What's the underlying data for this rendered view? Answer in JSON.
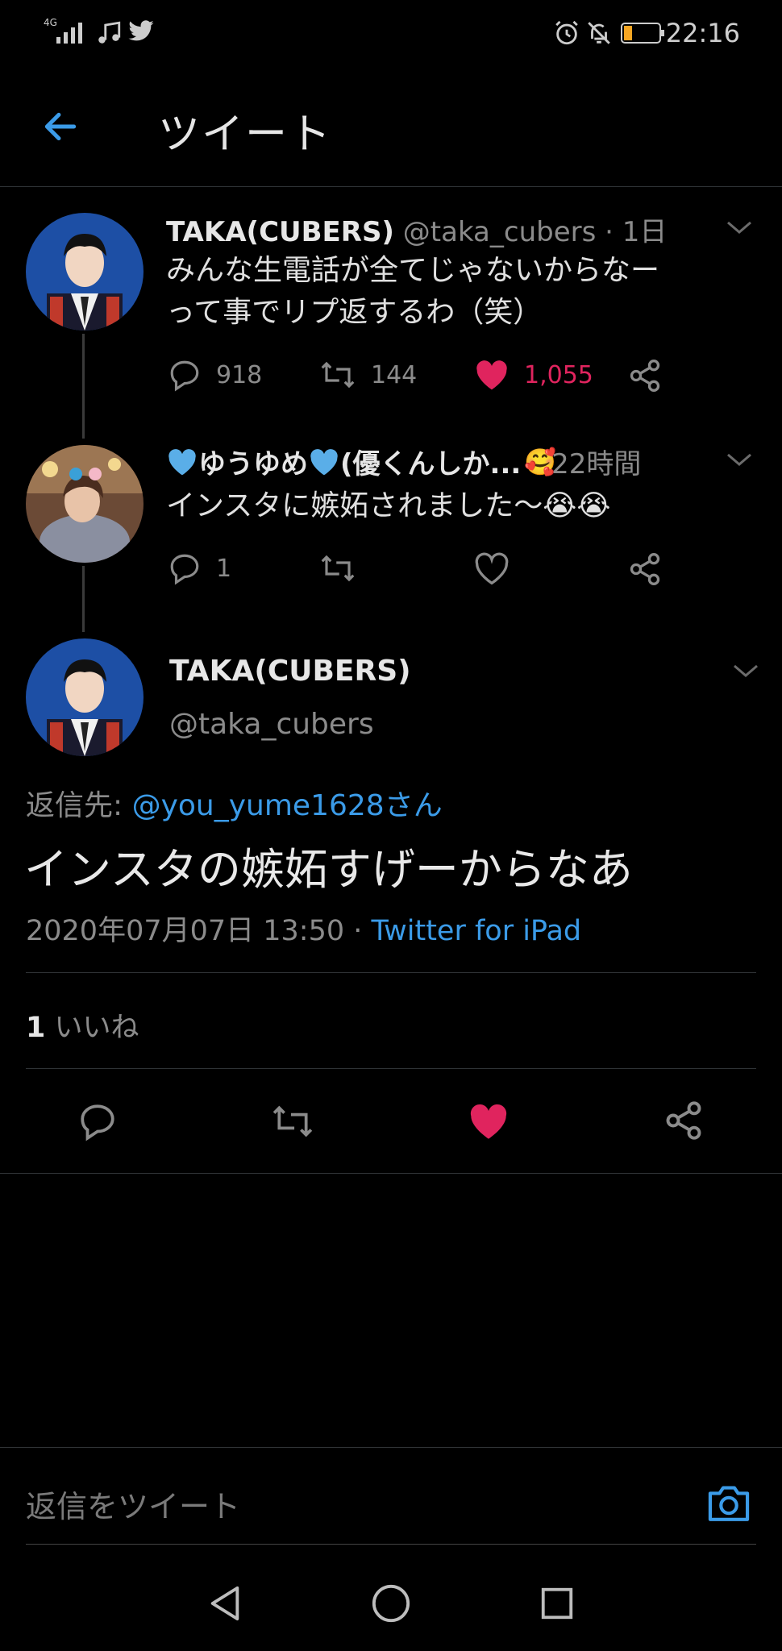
{
  "status_bar": {
    "network": "4G",
    "time": "22:16"
  },
  "header": {
    "title": "ツイート"
  },
  "thread": [
    {
      "name": "TAKA(CUBERS)",
      "handle": "@taka_cubers",
      "time": "· 1日",
      "text_line1": "みんな生電話が全てじゃないからなー",
      "text_line2": "って事でリプ返するわ（笑）",
      "replies": "918",
      "retweets": "144",
      "likes": "1,055"
    },
    {
      "name": "ゆうゆめ",
      "name_suffix": "(優くんしか...",
      "time": "22時間",
      "text": "インスタに嫉妬されました〜",
      "replies": "1"
    }
  ],
  "main_tweet": {
    "name": "TAKA(CUBERS)",
    "handle": "@taka_cubers",
    "reply_to_label": "返信先:",
    "reply_to_user": "@you_yume1628さん",
    "text": "インスタの嫉妬すげーからなあ",
    "timestamp": "2020年07月07日 13:50 ·",
    "source": "Twitter for iPad",
    "likes_count": "1",
    "likes_label": "いいね"
  },
  "reply_bar": {
    "placeholder": "返信をツイート"
  },
  "colors": {
    "accent_blue": "#3b9be8",
    "like_pink": "#e0245e",
    "background": "#000000"
  },
  "icons": [
    "back-arrow-icon",
    "reply-icon",
    "retweet-icon",
    "heart-icon",
    "share-icon",
    "chevron-down-icon",
    "camera-icon",
    "alarm-icon",
    "mute-icon",
    "battery-icon",
    "music-icon",
    "twitter-bird-icon"
  ]
}
